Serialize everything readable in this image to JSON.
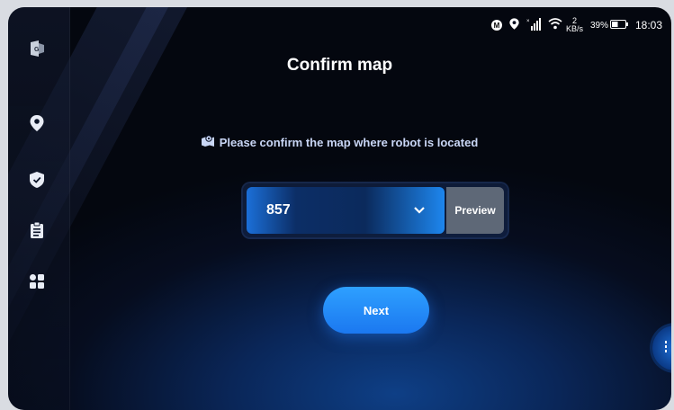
{
  "status_bar": {
    "m_badge": "M",
    "network_speed_value": "2",
    "network_speed_unit": "KB/s",
    "battery": "39%",
    "time": "18:03"
  },
  "page": {
    "title": "Confirm map",
    "prompt": "Please confirm the map where robot is located"
  },
  "map_select": {
    "selected_value": "857",
    "preview_label": "Preview"
  },
  "actions": {
    "next_label": "Next"
  },
  "sidebar": {
    "items": [
      {
        "icon": "logo-icon"
      },
      {
        "icon": "location-pin-icon"
      },
      {
        "icon": "shield-check-icon"
      },
      {
        "icon": "clipboard-icon"
      },
      {
        "icon": "apps-grid-icon"
      }
    ]
  },
  "colors": {
    "accent": "#1d86ee",
    "preview_bg": "#5e6877",
    "background": "#060d1f"
  }
}
